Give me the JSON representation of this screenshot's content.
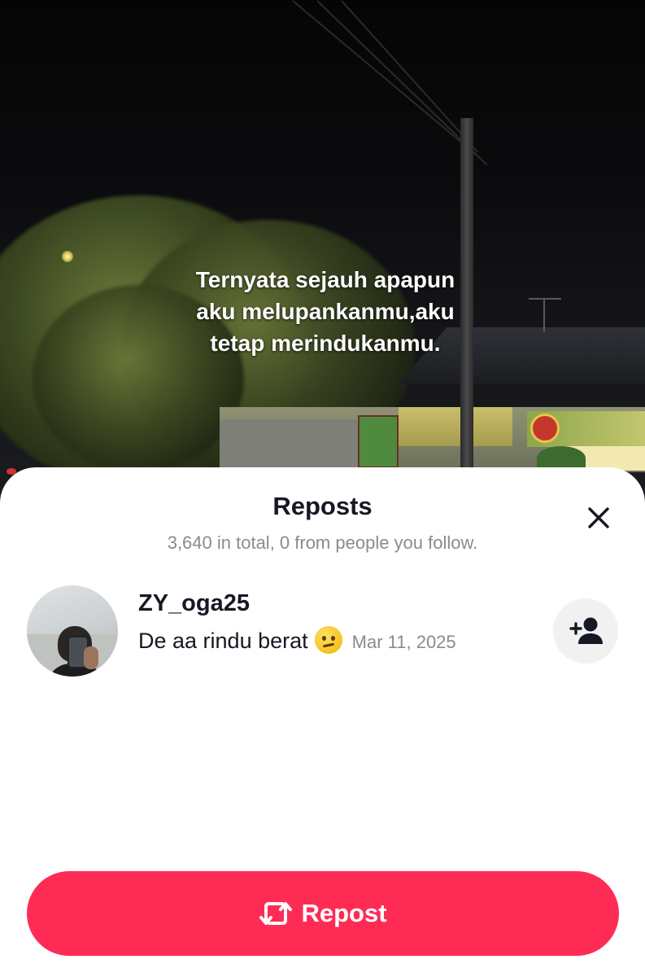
{
  "video": {
    "caption_lines": [
      "Ternyata sejauh apapun",
      "aku melupankanmu,aku",
      "tetap merindukanmu."
    ]
  },
  "sheet": {
    "title": "Reposts",
    "subtitle": "3,640 in total, 0 from people you follow."
  },
  "reposts": [
    {
      "username": "ZY_oga25",
      "comment": "De aa rindu berat",
      "emoji": "confused-face",
      "date": "Mar 11, 2025"
    }
  ],
  "icons": {
    "close": "close-icon",
    "follow": "add-user-icon",
    "repost": "repost-icon"
  },
  "actions": {
    "repost_label": "Repost"
  },
  "colors": {
    "accent": "#fe2c55",
    "text_primary": "#161823",
    "text_secondary": "#8a8b91"
  }
}
